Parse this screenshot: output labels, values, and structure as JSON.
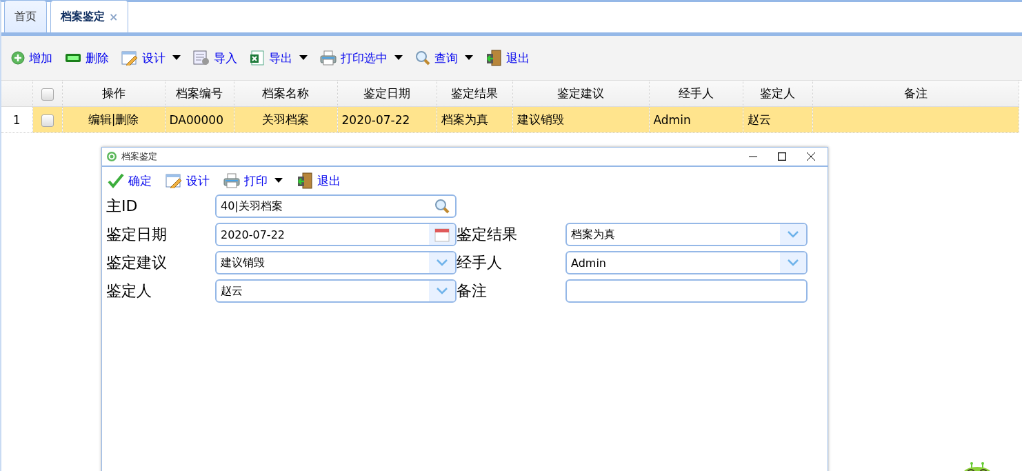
{
  "tabs": [
    {
      "label": "首页",
      "selected": false
    },
    {
      "label": "档案鉴定",
      "selected": true,
      "close": "×"
    }
  ],
  "toolbar": [
    {
      "label": "增加",
      "dropdown": false
    },
    {
      "label": "删除",
      "dropdown": false
    },
    {
      "label": "设计",
      "dropdown": true
    },
    {
      "label": "导入",
      "dropdown": false
    },
    {
      "label": "导出",
      "dropdown": true
    },
    {
      "label": "打印选中",
      "dropdown": true
    },
    {
      "label": "查询",
      "dropdown": true
    },
    {
      "label": "退出",
      "dropdown": false
    }
  ],
  "grid": {
    "header_checked": false,
    "columns": [
      "操作",
      "档案编号",
      "档案名称",
      "鉴定日期",
      "鉴定结果",
      "鉴定建议",
      "经手人",
      "鉴定人",
      "备注"
    ],
    "rows": [
      {
        "number": "1",
        "checked": false,
        "selected": true,
        "cells": [
          "编辑|删除",
          "DA00000",
          "关羽档案",
          "2020-07-22",
          "档案为真",
          "建议销毁",
          "Admin",
          "赵云",
          ""
        ]
      }
    ]
  },
  "dialog": {
    "title": "档案鉴定",
    "toolbar": [
      {
        "label": "确定",
        "dropdown": false
      },
      {
        "label": "设计",
        "dropdown": false
      },
      {
        "label": "打印",
        "dropdown": true
      },
      {
        "label": "退出",
        "dropdown": false
      }
    ],
    "rows": [
      [
        {
          "label": "主ID",
          "value": "40|关羽档案",
          "kind": "lookup"
        }
      ],
      [
        {
          "label": "鉴定日期",
          "value": "2020-07-22",
          "kind": "date"
        },
        {
          "label": "鉴定结果",
          "value": "档案为真",
          "kind": "select"
        }
      ],
      [
        {
          "label": "鉴定建议",
          "value": "建议销毁",
          "kind": "select"
        },
        {
          "label": "经手人",
          "value": "Admin",
          "kind": "select"
        }
      ],
      [
        {
          "label": "鉴定人",
          "value": "赵云",
          "kind": "select"
        },
        {
          "label": "备注",
          "kind": "text"
        }
      ]
    ]
  }
}
